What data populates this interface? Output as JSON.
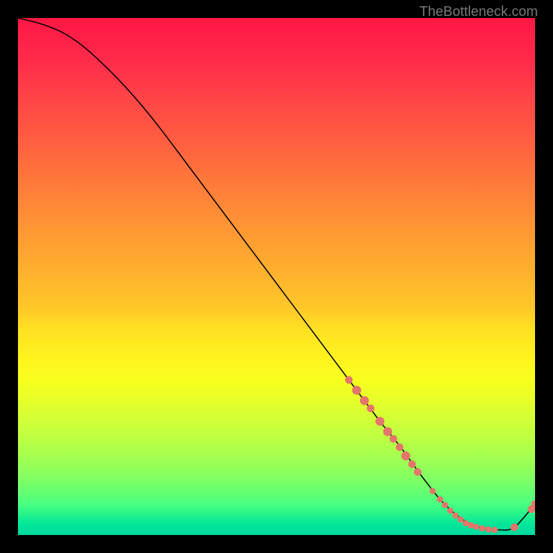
{
  "watermark": "TheBottleneck.com",
  "chart_data": {
    "type": "line",
    "title": "",
    "xlabel": "",
    "ylabel": "",
    "xlim": [
      0,
      100
    ],
    "ylim": [
      0,
      100
    ],
    "grid": false,
    "legend": false,
    "series": [
      {
        "name": "curve",
        "x": [
          0,
          4,
          8,
          12,
          16,
          20,
          24,
          28,
          34,
          40,
          46,
          52,
          58,
          64,
          70,
          74,
          78,
          82,
          86,
          90,
          93,
          96,
          100
        ],
        "y": [
          100,
          99,
          97.5,
          95,
          91.5,
          87.5,
          83,
          78,
          70,
          62,
          54,
          46,
          38,
          30,
          22,
          17,
          11.5,
          6.5,
          3,
          1.2,
          1,
          1.5,
          6
        ]
      }
    ],
    "scatter": {
      "name": "dots",
      "color": "#e5766b",
      "points": [
        {
          "x": 64.0,
          "y": 30.0,
          "r": 5
        },
        {
          "x": 65.5,
          "y": 28.0,
          "r": 6
        },
        {
          "x": 67.0,
          "y": 26.0,
          "r": 6
        },
        {
          "x": 68.2,
          "y": 24.5,
          "r": 5
        },
        {
          "x": 70.0,
          "y": 22.0,
          "r": 6
        },
        {
          "x": 71.5,
          "y": 20.0,
          "r": 6
        },
        {
          "x": 72.6,
          "y": 18.6,
          "r": 5
        },
        {
          "x": 73.8,
          "y": 17.0,
          "r": 5
        },
        {
          "x": 75.0,
          "y": 15.3,
          "r": 6
        },
        {
          "x": 76.2,
          "y": 13.7,
          "r": 5
        },
        {
          "x": 77.3,
          "y": 12.2,
          "r": 5
        },
        {
          "x": 80.2,
          "y": 8.5,
          "r": 4
        },
        {
          "x": 81.6,
          "y": 6.9,
          "r": 4
        },
        {
          "x": 82.6,
          "y": 5.8,
          "r": 4
        },
        {
          "x": 83.6,
          "y": 4.7,
          "r": 4
        },
        {
          "x": 84.6,
          "y": 3.8,
          "r": 4
        },
        {
          "x": 85.6,
          "y": 3.0,
          "r": 4
        },
        {
          "x": 86.6,
          "y": 2.3,
          "r": 4
        },
        {
          "x": 87.6,
          "y": 1.9,
          "r": 4
        },
        {
          "x": 88.6,
          "y": 1.6,
          "r": 4
        },
        {
          "x": 89.8,
          "y": 1.3,
          "r": 4
        },
        {
          "x": 91.0,
          "y": 1.1,
          "r": 4
        },
        {
          "x": 92.2,
          "y": 1.0,
          "r": 4
        },
        {
          "x": 96.0,
          "y": 1.5,
          "r": 5
        },
        {
          "x": 99.3,
          "y": 5.0,
          "r": 5
        },
        {
          "x": 100.0,
          "y": 6.0,
          "r": 5
        }
      ]
    },
    "background_gradient": {
      "stops": [
        {
          "pos": 0,
          "color": "#ff1744"
        },
        {
          "pos": 50,
          "color": "#ffc728"
        },
        {
          "pos": 70,
          "color": "#f7ff1e"
        },
        {
          "pos": 100,
          "color": "#00d89f"
        }
      ]
    }
  }
}
